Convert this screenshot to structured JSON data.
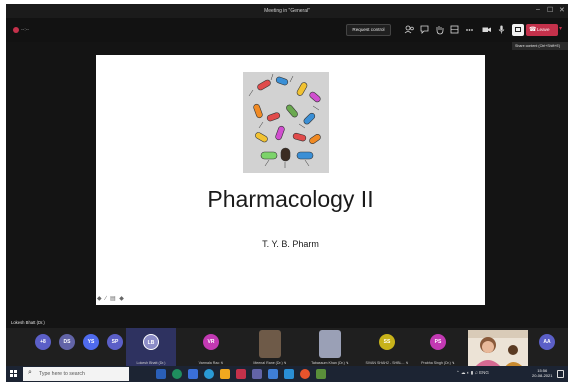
{
  "window": {
    "title": "Meeting in \"General\"",
    "minimize": "–",
    "maximize": "☐",
    "close": "✕"
  },
  "toolbar": {
    "timer": "--:--",
    "request_control": "Request control",
    "leave": "Leave",
    "tooltip": "Share content (Ctrl+Shift+E)"
  },
  "slide": {
    "title": "Pharmacology II",
    "subtitle": "T. Y. B. Pharm",
    "tools": "◆ ∕ ▤ ◆"
  },
  "presenter": "Lokesh Bhatt (Dr.)",
  "participants": [
    {
      "initials": "+8",
      "name": "",
      "color": "#5b5fc7"
    },
    {
      "initials": "DS",
      "name": "",
      "color": "#6264a7"
    },
    {
      "initials": "YS",
      "name": "",
      "color": "#4f6bed"
    },
    {
      "initials": "SP",
      "name": "",
      "color": "#5b5fc7"
    },
    {
      "initials": "LB",
      "name": "Lokesh Bhatt (Dr.)",
      "color": "#8b8cc7"
    },
    {
      "initials": "VR",
      "name": "Varmala Rao ↯",
      "color": "#c239b3"
    },
    {
      "initials": "",
      "name": "Meenal Rane (Dr.) ↯",
      "color": "#7a6a5a"
    },
    {
      "initials": "",
      "name": "Tabassum Khan (Dr.) ↯",
      "color": "#8a8fa8"
    },
    {
      "initials": "SS",
      "name": "SIVAN SHAH2 - SHBL... ↯",
      "color": "#c7b21a"
    },
    {
      "initials": "PS",
      "name": "Prabha Singh (Dr.) ↯",
      "color": "#c239b3"
    },
    {
      "initials": "AA",
      "name": "",
      "color": "#5b5fc7"
    }
  ],
  "taskbar": {
    "search_placeholder": "Type here to search",
    "tray": "⌃ ☁ ◐ ▮ ♫ ENG",
    "time": "15:56",
    "date": "20-08-2021"
  }
}
